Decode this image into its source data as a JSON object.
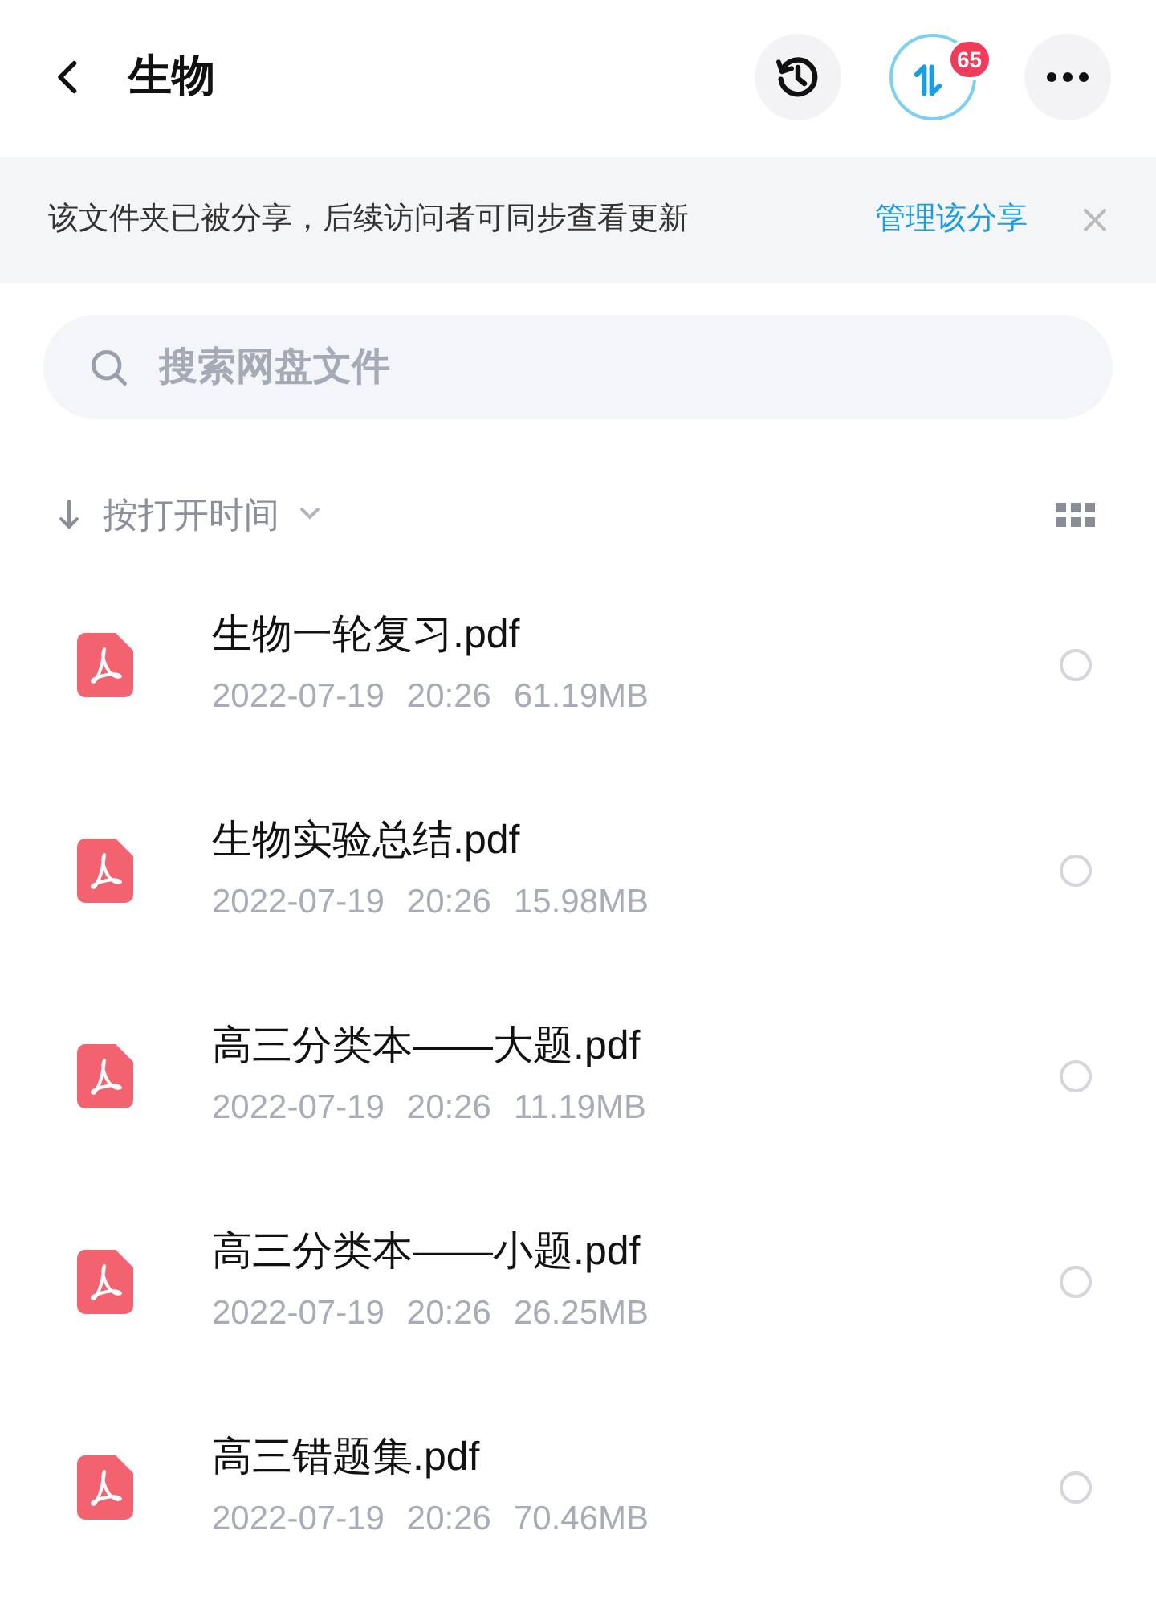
{
  "header": {
    "title": "生物",
    "transfer_badge": "65"
  },
  "share_banner": {
    "message": "该文件夹已被分享，后续访问者可同步查看更新",
    "action": "管理该分享"
  },
  "search": {
    "placeholder": "搜索网盘文件"
  },
  "sort": {
    "label": "按打开时间"
  },
  "files": [
    {
      "name": "生物一轮复习.pdf",
      "date": "2022-07-19",
      "time": "20:26",
      "size": "61.19MB",
      "selected": false
    },
    {
      "name": "生物实验总结.pdf",
      "date": "2022-07-19",
      "time": "20:26",
      "size": "15.98MB",
      "selected": false
    },
    {
      "name": "高三分类本——大题.pdf",
      "date": "2022-07-19",
      "time": "20:26",
      "size": "11.19MB",
      "selected": false
    },
    {
      "name": "高三分类本——小题.pdf",
      "date": "2022-07-19",
      "time": "20:26",
      "size": "26.25MB",
      "selected": false
    },
    {
      "name": "高三错题集.pdf",
      "date": "2022-07-19",
      "time": "20:26",
      "size": "70.46MB",
      "selected": false
    }
  ]
}
